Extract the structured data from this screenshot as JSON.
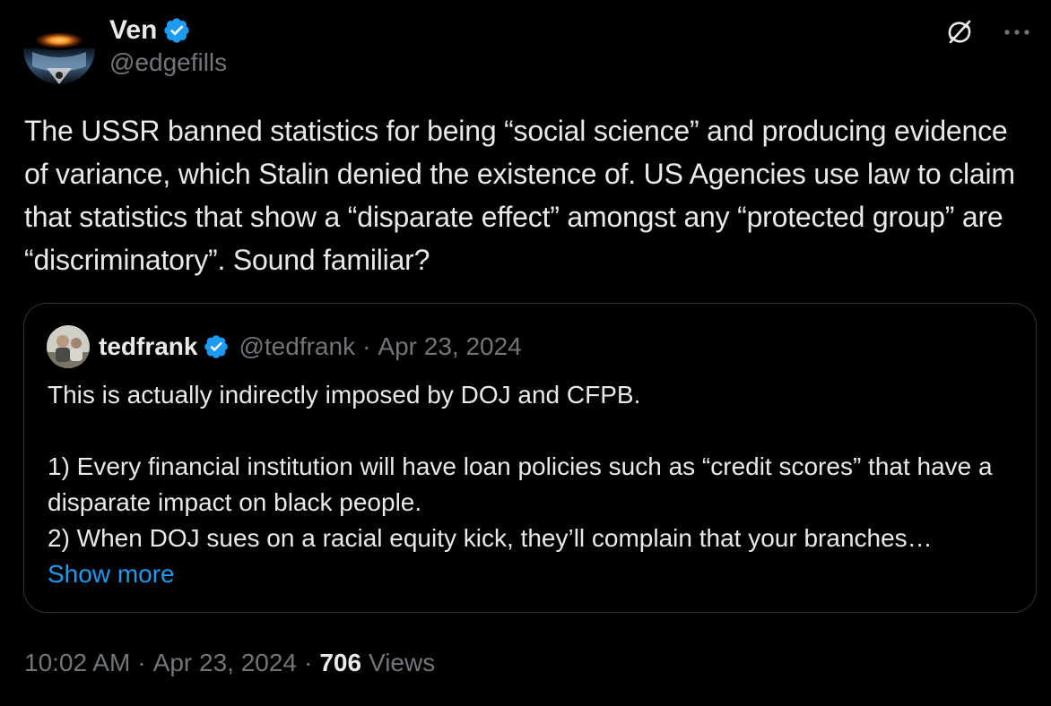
{
  "author": {
    "name": "Ven",
    "handle": "@edgefills",
    "verified": true
  },
  "tweet": {
    "text": "The USSR banned statistics for being “social science” and producing evidence of variance, which Stalin denied the existence of. US Agencies use law to claim that statistics that show a “disparate effect” amongst any “protected group” are “discriminatory”. Sound familiar?"
  },
  "quote": {
    "name": "tedfrank",
    "handle": "@tedfrank",
    "separator": "·",
    "date": "Apr 23, 2024",
    "verified": true,
    "text": "This is actually indirectly imposed by DOJ and CFPB.\n\n1) Every financial institution will have loan policies such as “credit scores” that have a disparate impact on black people.\n2) When DOJ sues on a racial equity kick, they’ll complain that your branches…",
    "show_more_label": "Show more"
  },
  "meta": {
    "time": "10:02 AM",
    "separator": "·",
    "date": "Apr 23, 2024",
    "views_count": "706",
    "views_label": "Views"
  },
  "icons": {
    "grok": "grok-icon",
    "more": "more-icon",
    "verified": "verified-badge-icon"
  },
  "colors": {
    "background": "#000000",
    "text": "#e7e9ea",
    "secondary": "#71767b",
    "accent": "#1d9bf0",
    "border": "#2f3336"
  }
}
